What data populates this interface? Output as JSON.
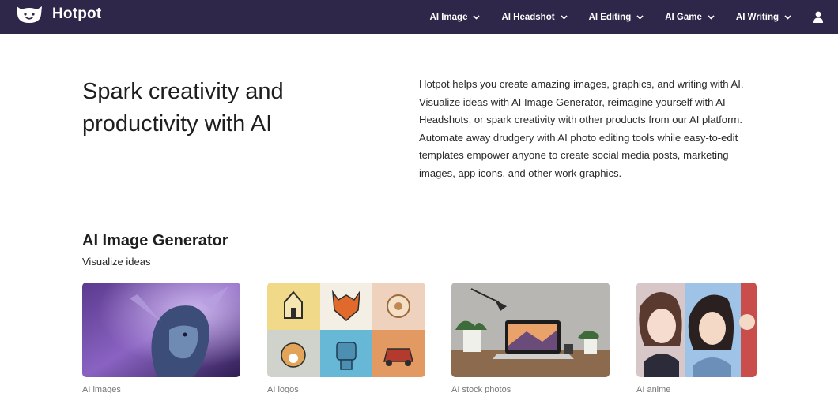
{
  "brand": {
    "name": "Hotpot"
  },
  "nav": {
    "items": [
      {
        "label": "AI Image"
      },
      {
        "label": "AI Headshot"
      },
      {
        "label": "AI Editing"
      },
      {
        "label": "AI Game"
      },
      {
        "label": "AI Writing"
      }
    ]
  },
  "hero": {
    "title": "Spark creativity and productivity with AI",
    "description": "Hotpot helps you create amazing images, graphics, and writing with AI. Visualize ideas with AI Image Generator, reimagine yourself with AI Headshots, or spark creativity with other products from our AI platform. Automate away drudgery with AI photo editing tools while easy-to-edit templates empower anyone to create social media posts, marketing images, app icons, and other work graphics."
  },
  "section": {
    "title": "AI Image Generator",
    "subtitle": "Visualize ideas",
    "cards": [
      {
        "label": "AI images"
      },
      {
        "label": "AI logos"
      },
      {
        "label": "AI stock photos"
      },
      {
        "label": "AI anime"
      }
    ]
  },
  "colors": {
    "nav_bg": "#2f2749",
    "text": "#1e1e1e"
  }
}
